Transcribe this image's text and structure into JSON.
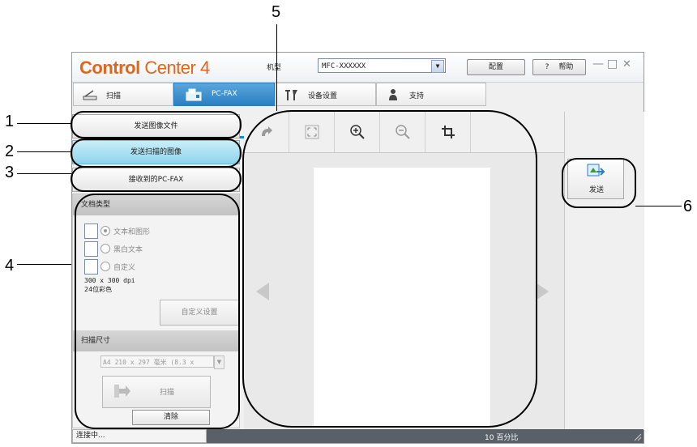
{
  "window": {
    "brand_orange": "Control",
    "brand_rest": " Center 4",
    "model_label": "机型",
    "model_value": "MFC-XXXXXX",
    "config_label": "配置",
    "help_label": "帮助",
    "help_q": "?",
    "min": "—",
    "max": "□",
    "close": "✕"
  },
  "tabs": [
    {
      "label": "扫描",
      "icon": "scanner-icon"
    },
    {
      "label": "PC-FAX",
      "icon": "fax-icon"
    },
    {
      "label": "设备设置",
      "icon": "tools-icon"
    },
    {
      "label": "支持",
      "icon": "support-icon"
    }
  ],
  "left": {
    "send_image_file": "发送图像文件",
    "send_scanned_image": "发送扫描的图像",
    "received_pcfax": "接收到的PC-FAX",
    "doc_type_header": "文档类型",
    "options": [
      "文本和图形",
      "黑白文本",
      "自定义"
    ],
    "resolution": "300 x 300 dpi",
    "color": "24位彩色",
    "custom_settings": "自定义设置",
    "scan_size_header": "扫描尺寸",
    "scan_size_value": "A4 210 x 297 毫米 (8.3 x",
    "scan_button": "扫描",
    "clear_button": "清除"
  },
  "right": {
    "send_label": "发送"
  },
  "status": {
    "left": "连接中...",
    "zoom": "10 百分比"
  },
  "callouts": {
    "c1": "1",
    "c2": "2",
    "c3": "3",
    "c4": "4",
    "c5": "5",
    "c6": "6"
  },
  "colors": {
    "brand": "#e1661a",
    "tab_active": "#2a7fc3",
    "selected_button": "#8fd4ec"
  }
}
